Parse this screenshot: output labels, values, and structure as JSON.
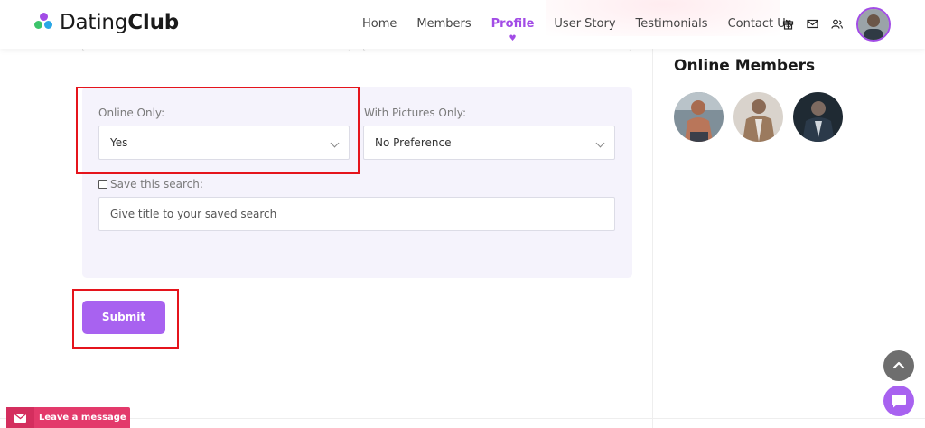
{
  "brand": {
    "name_regular": "Dating",
    "name_bold": "Club"
  },
  "nav": {
    "items": [
      {
        "label": "Home",
        "active": false
      },
      {
        "label": "Members",
        "active": false
      },
      {
        "label": "Profile",
        "active": true
      },
      {
        "label": "User Story",
        "active": false
      },
      {
        "label": "Testimonials",
        "active": false
      },
      {
        "label": "Contact Us",
        "active": false
      }
    ],
    "icons": [
      "gift-icon",
      "mail-icon",
      "users-icon"
    ]
  },
  "form": {
    "online_only": {
      "label": "Online Only:",
      "value": "Yes"
    },
    "with_pictures": {
      "label": "With Pictures Only:",
      "value": "No Preference"
    },
    "save_search": {
      "label": "Save this search:",
      "checked": false
    },
    "title_input": {
      "placeholder": "Give title to your saved search"
    },
    "submit_label": "Submit"
  },
  "sidebar": {
    "title": "Online Members",
    "members": [
      "member-1",
      "member-2",
      "member-3"
    ]
  },
  "widgets": {
    "leave_message": "Leave a message"
  },
  "colors": {
    "accent": "#a24ce6",
    "button": "#a862f0",
    "highlight": "#e5141c",
    "leave_message_bg": "#e33a6b"
  }
}
